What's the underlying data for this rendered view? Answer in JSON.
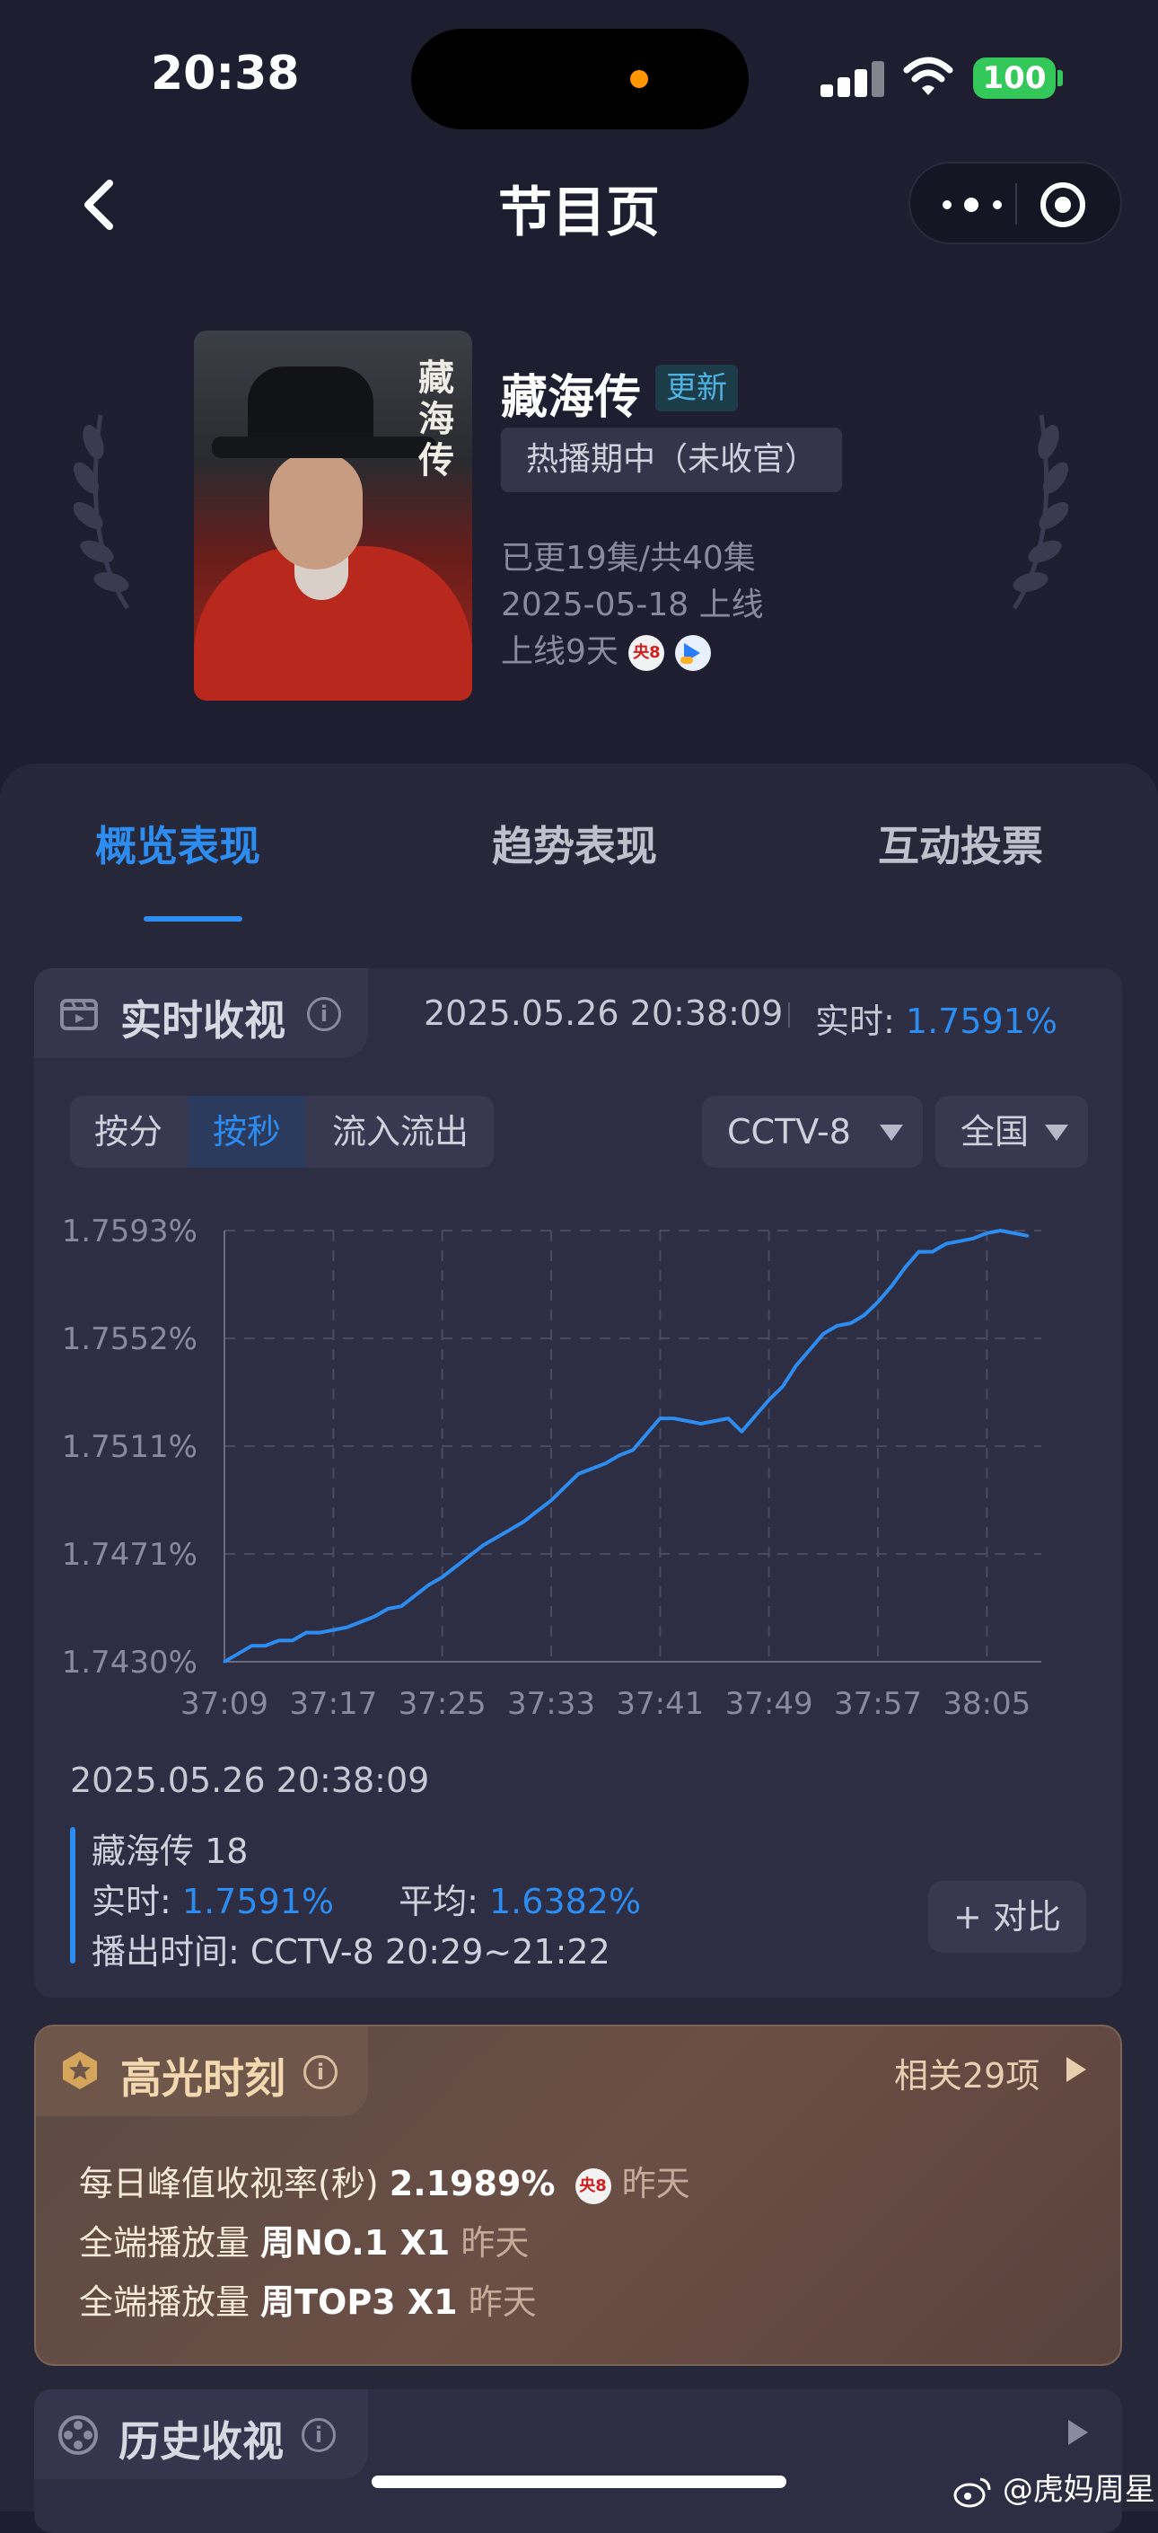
{
  "status_bar": {
    "time": "20:38",
    "battery": "100"
  },
  "nav": {
    "title": "节目页"
  },
  "show": {
    "title": "藏海传",
    "update_tag": "更新",
    "status_tag": "热播期中（未收官）",
    "episodes": "已更19集/共40集",
    "premiere": "2025-05-18 上线",
    "days_online": "上线9天",
    "poster_text": "藏海传",
    "channel_logo": "央8"
  },
  "tabs": [
    "概览表现",
    "趋势表现",
    "互动投票"
  ],
  "realtime": {
    "title": "实时收视",
    "info": "i",
    "timestamp": "2025.05.26 20:38:09",
    "live_label": "实时:",
    "live_value": "1.7591%",
    "segments": [
      "按分",
      "按秒",
      "流入流出"
    ],
    "active_segment": "按秒",
    "channel_select": "CCTV-8",
    "region_select": "全国",
    "tooltip_date": "2025.05.26 20:38:09",
    "legend_name": "藏海传 18",
    "live_text": "实时:",
    "avg_label": "平均:",
    "avg_value": "1.6382%",
    "air_time": "播出时间:  CCTV-8 20:29~21:22",
    "compare_button": "+ 对比"
  },
  "chart_data": {
    "type": "line",
    "title": "",
    "xlabel": "",
    "ylabel": "",
    "x_ticks": [
      "37:09",
      "37:17",
      "37:25",
      "37:33",
      "37:41",
      "37:49",
      "37:57",
      "38:05"
    ],
    "y_ticks": [
      "1.7430%",
      "1.7471%",
      "1.7511%",
      "1.7552%",
      "1.7593%"
    ],
    "ylim": [
      1.743,
      1.7593
    ],
    "xlim_seconds": [
      0,
      60
    ],
    "grid": true,
    "line_color": "#2d8cf0",
    "series": [
      {
        "values": [
          [
            0,
            1.743
          ],
          [
            1,
            1.7433
          ],
          [
            2,
            1.7436
          ],
          [
            3,
            1.7436
          ],
          [
            4,
            1.7438
          ],
          [
            5,
            1.7438
          ],
          [
            6,
            1.7441
          ],
          [
            7,
            1.7441
          ],
          [
            8,
            1.7442
          ],
          [
            9,
            1.7443
          ],
          [
            10,
            1.7445
          ],
          [
            11,
            1.7447
          ],
          [
            12,
            1.745
          ],
          [
            13,
            1.7451
          ],
          [
            14,
            1.7455
          ],
          [
            15,
            1.7459
          ],
          [
            16,
            1.7462
          ],
          [
            17,
            1.7466
          ],
          [
            18,
            1.747
          ],
          [
            19,
            1.7474
          ],
          [
            20,
            1.7477
          ],
          [
            21,
            1.748
          ],
          [
            22,
            1.7483
          ],
          [
            23,
            1.7487
          ],
          [
            24,
            1.7491
          ],
          [
            25,
            1.7496
          ],
          [
            26,
            1.7501
          ],
          [
            27,
            1.7503
          ],
          [
            28,
            1.7505
          ],
          [
            29,
            1.7508
          ],
          [
            30,
            1.751
          ],
          [
            31,
            1.7516
          ],
          [
            32,
            1.7522
          ],
          [
            33,
            1.7522
          ],
          [
            34,
            1.7521
          ],
          [
            35,
            1.752
          ],
          [
            36,
            1.7521
          ],
          [
            37,
            1.7522
          ],
          [
            38,
            1.7517
          ],
          [
            39,
            1.7523
          ],
          [
            40,
            1.7529
          ],
          [
            41,
            1.7534
          ],
          [
            42,
            1.7542
          ],
          [
            43,
            1.7548
          ],
          [
            44,
            1.7554
          ],
          [
            45,
            1.7557
          ],
          [
            46,
            1.7558
          ],
          [
            47,
            1.7561
          ],
          [
            48,
            1.7566
          ],
          [
            49,
            1.7572
          ],
          [
            50,
            1.7579
          ],
          [
            51,
            1.7585
          ],
          [
            52,
            1.7585
          ],
          [
            53,
            1.7588
          ],
          [
            54,
            1.7589
          ],
          [
            55,
            1.759
          ],
          [
            56,
            1.7592
          ],
          [
            57,
            1.7593
          ],
          [
            58,
            1.7592
          ],
          [
            59,
            1.7591
          ]
        ]
      }
    ]
  },
  "highlights": {
    "title": "高光时刻",
    "info": "i",
    "more": "相关29项",
    "rows": [
      {
        "label": "每日峰值收视率(秒)",
        "value": "2.1989%",
        "logo": "央8",
        "when": "昨天"
      },
      {
        "label": "全端播放量",
        "value": "周NO.1 X1",
        "when": "昨天"
      },
      {
        "label": "全端播放量",
        "value": "周TOP3 X1",
        "when": "昨天"
      }
    ]
  },
  "history": {
    "title": "历史收视",
    "info": "i"
  },
  "watermark": "@虎妈周星"
}
